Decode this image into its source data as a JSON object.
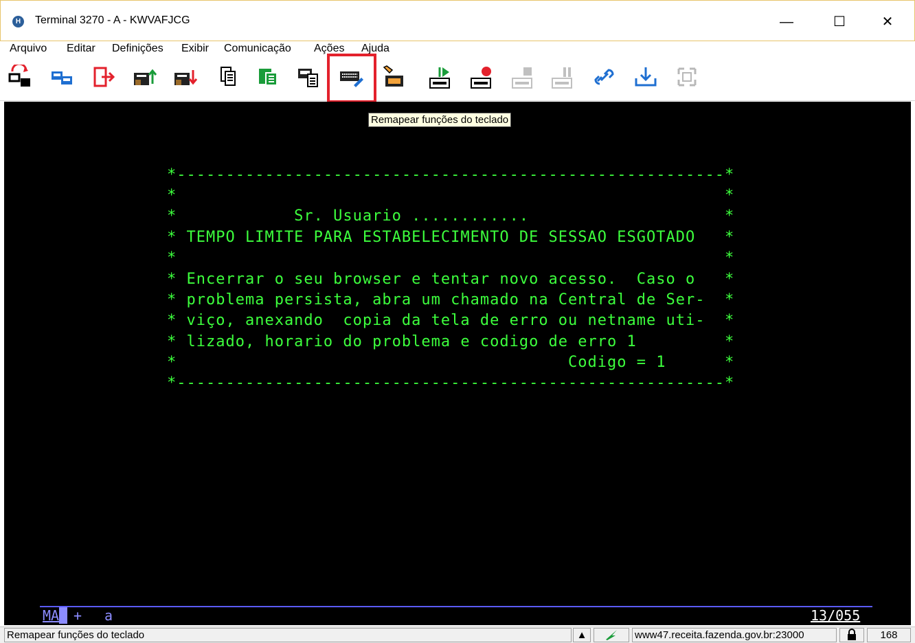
{
  "window": {
    "title": "Terminal 3270 - A - KWVAFJCG",
    "app_icon_letter": "H",
    "minimize_glyph": "—",
    "maximize_glyph": "☐",
    "close_glyph": "✕"
  },
  "menu": [
    {
      "label": "Arquivo"
    },
    {
      "label": "Editar"
    },
    {
      "label": "Definições"
    },
    {
      "label": "Exibir"
    },
    {
      "label": "Comunicação"
    },
    {
      "label": "Ações"
    },
    {
      "label": "Ajuda"
    }
  ],
  "toolbar": {
    "tooltip": "Remapear funções do teclado",
    "highlight_color": "#e3212c",
    "buttons": [
      {
        "icon": "new-session-icon"
      },
      {
        "icon": "copy-session-icon"
      },
      {
        "icon": "exit-icon"
      },
      {
        "icon": "send-file-icon"
      },
      {
        "icon": "receive-file-icon"
      },
      {
        "icon": "copy-icon"
      },
      {
        "icon": "paste-icon"
      },
      {
        "icon": "print-screen-icon"
      },
      {
        "icon": "keyboard-remap-icon"
      },
      {
        "icon": "color-remap-icon"
      },
      {
        "icon": "macro-play-icon"
      },
      {
        "icon": "macro-record-icon"
      },
      {
        "icon": "macro-stop-icon"
      },
      {
        "icon": "macro-pause-icon"
      },
      {
        "icon": "link-icon"
      },
      {
        "icon": "download-icon"
      },
      {
        "icon": "disconnect-icon"
      }
    ]
  },
  "terminal": {
    "text_color": "#3dff3d",
    "lines": [
      "*--------------------------------------------------------*",
      "*                                                        *",
      "*            Sr. Usuario ............                    *",
      "* TEMPO LIMITE PARA ESTABELECIMENTO DE SESSAO ESGOTADO   *",
      "*                                                        *",
      "* Encerrar o seu browser e tentar novo acesso.  Caso o   *",
      "* problema persista, abra um chamado na Central de Ser-  *",
      "* viço, anexando  copia da tela de erro ou netname uti-  *",
      "* lizado, horario do problema e codigo de erro 1         *",
      "*                                        Codigo = 1      *",
      "*--------------------------------------------------------*"
    ]
  },
  "oia": {
    "left": "MA",
    "indicator": "+",
    "mode": "a",
    "cursor_pos": "13/055"
  },
  "statusbar": {
    "message": "Remapear funções do teclado",
    "host": "www47.receita.fazenda.gov.br:23000",
    "count": "168"
  }
}
